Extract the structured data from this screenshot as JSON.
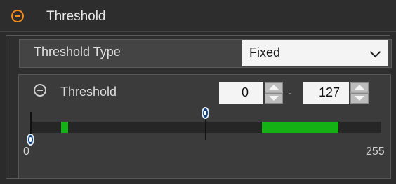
{
  "header": {
    "title": "Threshold",
    "icon": "collapse-icon"
  },
  "threshold_type": {
    "label": "Threshold Type",
    "selected": "Fixed"
  },
  "threshold": {
    "label": "Threshold",
    "min_value": "0",
    "max_value": "127",
    "separator": "-",
    "range_min_label": "0",
    "range_max_label": "255",
    "range_min": 0,
    "range_max": 255,
    "low_handle": 0,
    "high_handle": 127
  },
  "histogram_highlights": [
    {
      "from": 22,
      "to": 27
    },
    {
      "from": 168,
      "to": 224
    }
  ],
  "colors": {
    "accent": "#f08b1e",
    "highlight": "#14b214",
    "track": "#262626",
    "handle": "#0e3f78"
  }
}
